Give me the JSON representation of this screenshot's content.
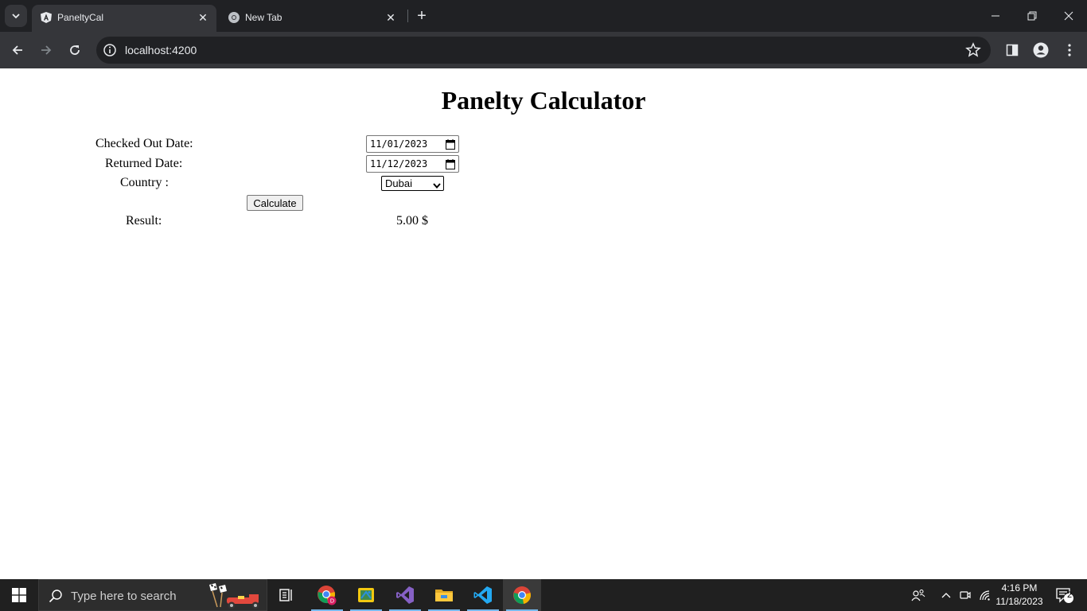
{
  "browser": {
    "tabs": [
      {
        "title": "PaneltyCal",
        "favicon": "angular-icon",
        "active": true
      },
      {
        "title": "New Tab",
        "favicon": "chrome-icon",
        "active": false
      }
    ],
    "url": "localhost:4200"
  },
  "page": {
    "title": "Panelty Calculator",
    "checked_out_label": "Checked Out Date:",
    "checked_out_value": "11/01/2023",
    "returned_label": "Returned Date:",
    "returned_value": "11/12/2023",
    "country_label": "Country :",
    "country_selected": "Dubai",
    "calculate_label": "Calculate",
    "result_label": "Result:",
    "result_value": "5.00 $"
  },
  "taskbar": {
    "search_placeholder": "Type here to search",
    "time": "4:16 PM",
    "date": "11/18/2023",
    "notification_count": "2",
    "apps": [
      "chrome-profile-icon",
      "sticky-app-icon",
      "visual-studio-icon",
      "file-explorer-icon",
      "vscode-icon",
      "chrome-icon"
    ]
  },
  "colors": {
    "chrome_dark": "#202124",
    "chrome_toolbar": "#35363a",
    "taskbar_bg": "#202020",
    "accent": "#76b9ed"
  }
}
